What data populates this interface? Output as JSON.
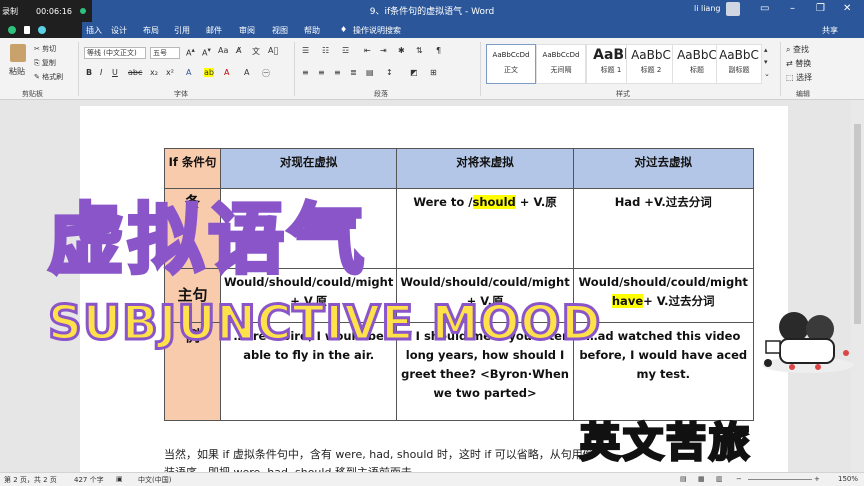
{
  "recorder": {
    "label": "录制",
    "time": "00:06:16"
  },
  "window": {
    "title": "9、if条件句的虚拟语气 - Word",
    "user": "li liang"
  },
  "menu": {
    "items": [
      "插入",
      "设计",
      "布局",
      "引用",
      "邮件",
      "审阅",
      "视图",
      "帮助"
    ],
    "tell_me": "操作说明搜索",
    "share": "共享"
  },
  "ribbon": {
    "clipboard": {
      "paste": "粘贴",
      "cut": "剪切",
      "copy": "复制",
      "format_painter": "格式刷",
      "label": "剪贴板"
    },
    "font": {
      "name": "等线 (中文正文)",
      "size": "五号",
      "label": "字体"
    },
    "paragraph": {
      "label": "段落"
    },
    "styles": {
      "label": "样式",
      "cards": [
        {
          "sample": "AaBbCcDd",
          "name": "正文"
        },
        {
          "sample": "AaBbCcDd",
          "name": "无间隔"
        },
        {
          "sample": "AaBl",
          "name": "标题 1"
        },
        {
          "sample": "AaBbC",
          "name": "标题 2"
        },
        {
          "sample": "AaBbC",
          "name": "标题"
        },
        {
          "sample": "AaBbC",
          "name": "副标题"
        }
      ]
    },
    "editing": {
      "find": "查找",
      "replace": "替换",
      "select": "选择",
      "label": "编辑"
    }
  },
  "table": {
    "header": [
      "If 条件句",
      "对现在虚拟",
      "对将来虚拟",
      "对过去虚拟"
    ],
    "row1": {
      "label": "条",
      "present": "",
      "future_a": "Were to /",
      "future_hl": "should",
      "future_b": " + V.原",
      "past": "Had +V.过去分词"
    },
    "row2": {
      "label": "主句",
      "present": "Would/should/could/might + V.原",
      "future": "Would/should/could/might + V.原",
      "past_a": "Would/should/could/might ",
      "past_hl": "have",
      "past_b": "+ V.过去分词"
    },
    "row3": {
      "label": "例",
      "present": "…ere a bird, I would be able to fly in the air.",
      "future": "If I should meet you after long years, how should I greet thee? <Byron·When we two parted>",
      "past": "…ad watched this video before, I would have aced my test."
    }
  },
  "body_text": {
    "line1": "当然，如果 if 虚拟条件句中，含有 were, had, should 时，这时 if 可以省略，从句用倒",
    "line2": "装语序，即把 were, had, should 移到主语前面去。"
  },
  "overlay": {
    "title_cn": "虚拟语气",
    "title_en": "SUBJUNCTIVE MOOD",
    "watermark": "英文苦旅"
  },
  "status": {
    "page": "第 2 页，共 2 页",
    "words": "427 个字",
    "lang": "中文(中国)",
    "zoom": "150%"
  },
  "colors": {
    "word_blue": "#2b579a",
    "header_blue": "#b4c6e7",
    "label_salmon": "#f8cbad",
    "highlight": "#ffff00",
    "overlay_yellow": "#ffe24a",
    "overlay_purple": "#8a55c9"
  }
}
